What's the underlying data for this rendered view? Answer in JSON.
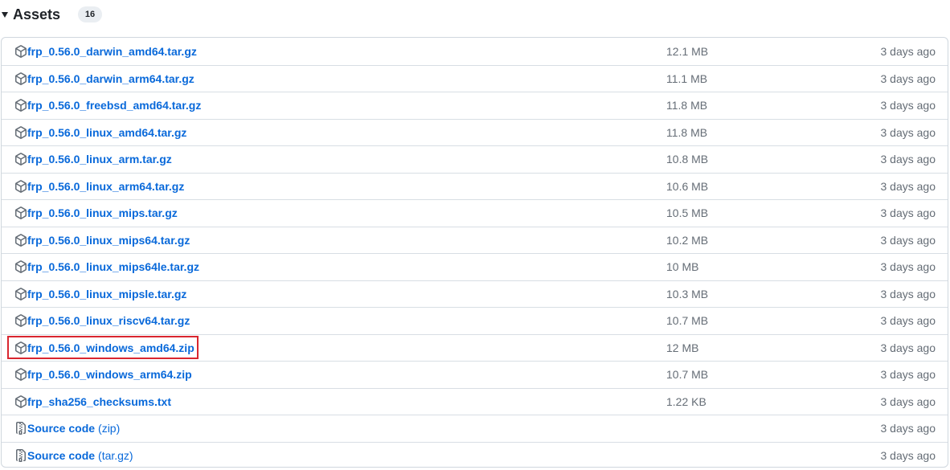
{
  "assets": {
    "title": "Assets",
    "count": "16",
    "items": [
      {
        "name": "frp_0.56.0_darwin_amd64.tar.gz",
        "sub": "",
        "size": "12.1 MB",
        "time": "3 days ago",
        "icon": "package-icon"
      },
      {
        "name": "frp_0.56.0_darwin_arm64.tar.gz",
        "sub": "",
        "size": "11.1 MB",
        "time": "3 days ago",
        "icon": "package-icon"
      },
      {
        "name": "frp_0.56.0_freebsd_amd64.tar.gz",
        "sub": "",
        "size": "11.8 MB",
        "time": "3 days ago",
        "icon": "package-icon"
      },
      {
        "name": "frp_0.56.0_linux_amd64.tar.gz",
        "sub": "",
        "size": "11.8 MB",
        "time": "3 days ago",
        "icon": "package-icon"
      },
      {
        "name": "frp_0.56.0_linux_arm.tar.gz",
        "sub": "",
        "size": "10.8 MB",
        "time": "3 days ago",
        "icon": "package-icon"
      },
      {
        "name": "frp_0.56.0_linux_arm64.tar.gz",
        "sub": "",
        "size": "10.6 MB",
        "time": "3 days ago",
        "icon": "package-icon"
      },
      {
        "name": "frp_0.56.0_linux_mips.tar.gz",
        "sub": "",
        "size": "10.5 MB",
        "time": "3 days ago",
        "icon": "package-icon"
      },
      {
        "name": "frp_0.56.0_linux_mips64.tar.gz",
        "sub": "",
        "size": "10.2 MB",
        "time": "3 days ago",
        "icon": "package-icon"
      },
      {
        "name": "frp_0.56.0_linux_mips64le.tar.gz",
        "sub": "",
        "size": "10 MB",
        "time": "3 days ago",
        "icon": "package-icon"
      },
      {
        "name": "frp_0.56.0_linux_mipsle.tar.gz",
        "sub": "",
        "size": "10.3 MB",
        "time": "3 days ago",
        "icon": "package-icon"
      },
      {
        "name": "frp_0.56.0_linux_riscv64.tar.gz",
        "sub": "",
        "size": "10.7 MB",
        "time": "3 days ago",
        "icon": "package-icon"
      },
      {
        "name": "frp_0.56.0_windows_amd64.zip",
        "sub": "",
        "size": "12 MB",
        "time": "3 days ago",
        "icon": "package-icon",
        "highlighted": true
      },
      {
        "name": "frp_0.56.0_windows_arm64.zip",
        "sub": "",
        "size": "10.7 MB",
        "time": "3 days ago",
        "icon": "package-icon"
      },
      {
        "name": "frp_sha256_checksums.txt",
        "sub": "",
        "size": "1.22 KB",
        "time": "3 days ago",
        "icon": "package-icon"
      },
      {
        "name": "Source code",
        "sub": "(zip)",
        "size": "",
        "time": "3 days ago",
        "icon": "file-zip-icon"
      },
      {
        "name": "Source code",
        "sub": "(tar.gz)",
        "size": "",
        "time": "3 days ago",
        "icon": "file-zip-icon"
      }
    ]
  },
  "colors": {
    "link": "#0969da",
    "muted": "#656d76",
    "highlight": "#d9262f"
  }
}
